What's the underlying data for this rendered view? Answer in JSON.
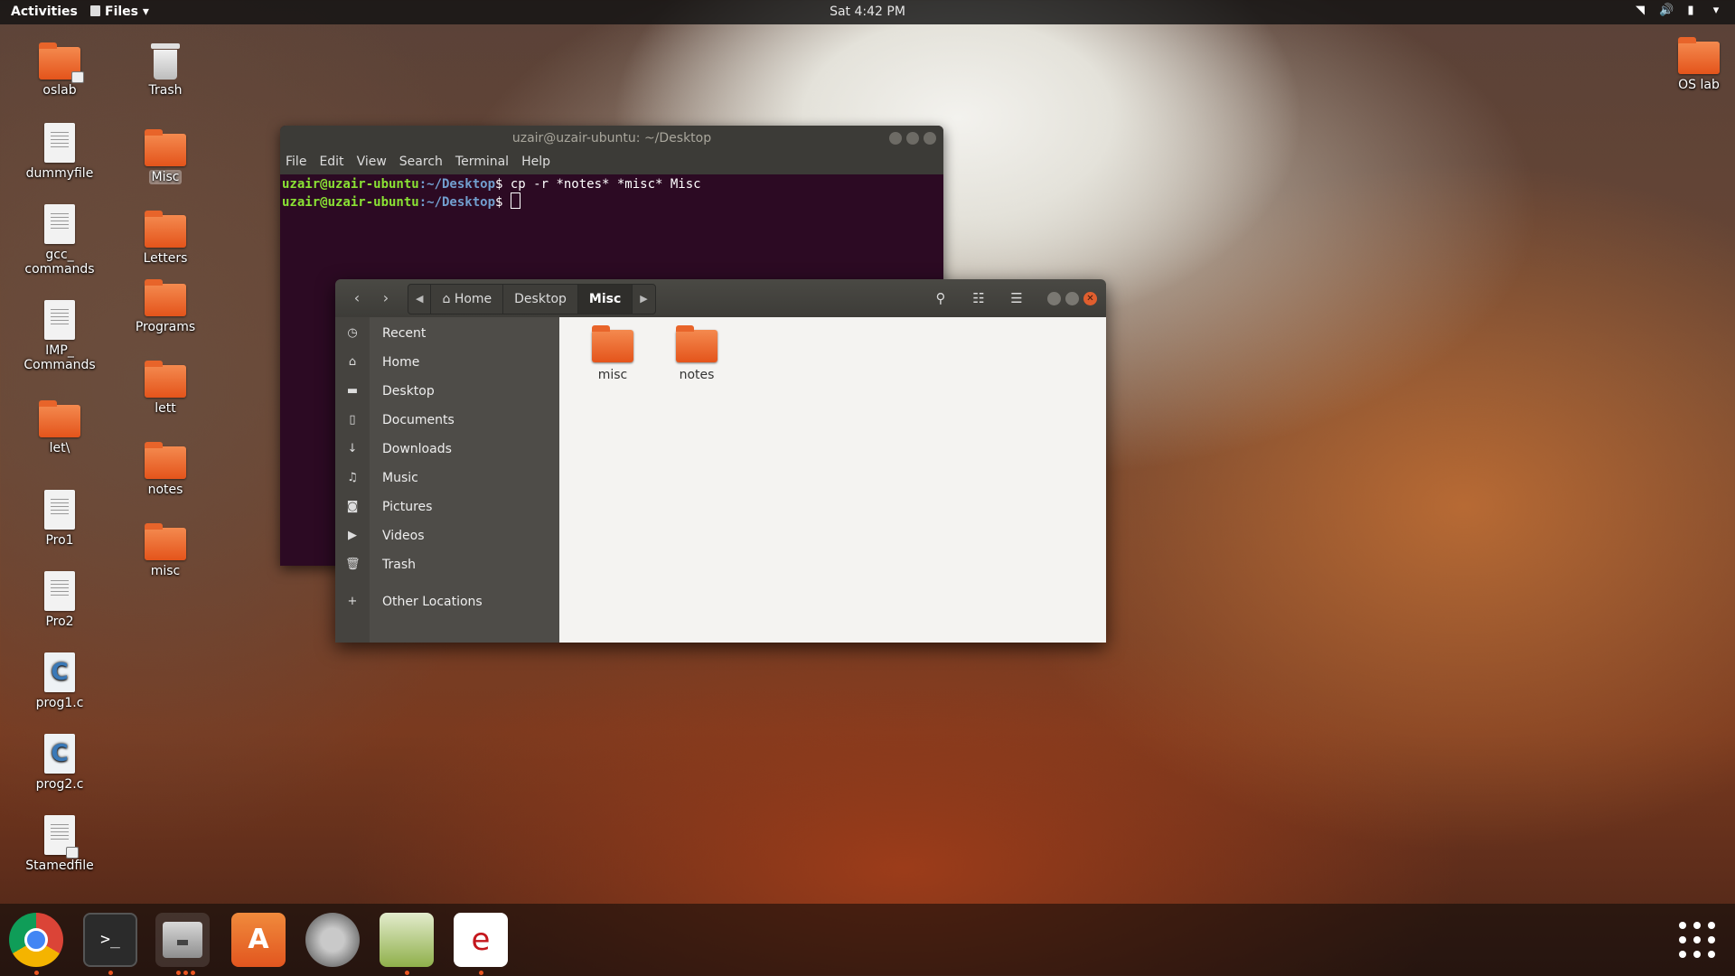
{
  "topbar": {
    "activities": "Activities",
    "app_menu": "Files",
    "clock": "Sat  4:42 PM"
  },
  "desktop": {
    "left_column": [
      {
        "label": "oslab",
        "type": "folder",
        "locked": true
      },
      {
        "label": "dummyfile",
        "type": "doc"
      },
      {
        "label": "gcc_\ncommands",
        "type": "doc"
      },
      {
        "label": "IMP_\nCommands",
        "type": "doc"
      },
      {
        "label": "let\\",
        "type": "folder"
      },
      {
        "label": "Pro1",
        "type": "doc"
      },
      {
        "label": "Pro2",
        "type": "doc"
      },
      {
        "label": "prog1.c",
        "type": "c"
      },
      {
        "label": "prog2.c",
        "type": "c"
      },
      {
        "label": "Stamedfile",
        "type": "doc",
        "locked": true
      }
    ],
    "right_column": [
      {
        "label": "Trash",
        "type": "trash"
      },
      {
        "label": "Misc",
        "type": "folder",
        "selected": true
      },
      {
        "label": "Letters",
        "type": "folder"
      },
      {
        "label": "Programs",
        "type": "folder"
      },
      {
        "label": "lett",
        "type": "folder"
      },
      {
        "label": "notes",
        "type": "folder"
      },
      {
        "label": "misc",
        "type": "folder"
      }
    ],
    "top_right": {
      "label": "OS lab",
      "type": "folder"
    }
  },
  "terminal": {
    "title": "uzair@uzair-ubuntu: ~/Desktop",
    "menu": [
      "File",
      "Edit",
      "View",
      "Search",
      "Terminal",
      "Help"
    ],
    "lines": [
      {
        "prompt": "uzair@uzair-ubuntu",
        "path": ":~/Desktop",
        "cmd": "$ cp -r *notes* *misc* Misc"
      },
      {
        "prompt": "uzair@uzair-ubuntu",
        "path": ":~/Desktop",
        "cmd": "$ "
      }
    ]
  },
  "files": {
    "breadcrumbs": [
      "Home",
      "Desktop",
      "Misc"
    ],
    "sidebar": [
      {
        "label": "Recent",
        "icon": "clock-icon"
      },
      {
        "label": "Home",
        "icon": "home-icon"
      },
      {
        "label": "Desktop",
        "icon": "folder-icon"
      },
      {
        "label": "Documents",
        "icon": "document-icon"
      },
      {
        "label": "Downloads",
        "icon": "download-icon"
      },
      {
        "label": "Music",
        "icon": "music-icon"
      },
      {
        "label": "Pictures",
        "icon": "camera-icon"
      },
      {
        "label": "Videos",
        "icon": "video-icon"
      },
      {
        "label": "Trash",
        "icon": "trash-icon"
      },
      {
        "label": "Other Locations",
        "icon": "plus-icon"
      }
    ],
    "items": [
      {
        "label": "misc"
      },
      {
        "label": "notes"
      }
    ]
  },
  "colors": {
    "accent": "#e95420",
    "terminal_bg": "#2c0a23",
    "prompt_green": "#8ae234",
    "path_blue": "#729fcf"
  }
}
